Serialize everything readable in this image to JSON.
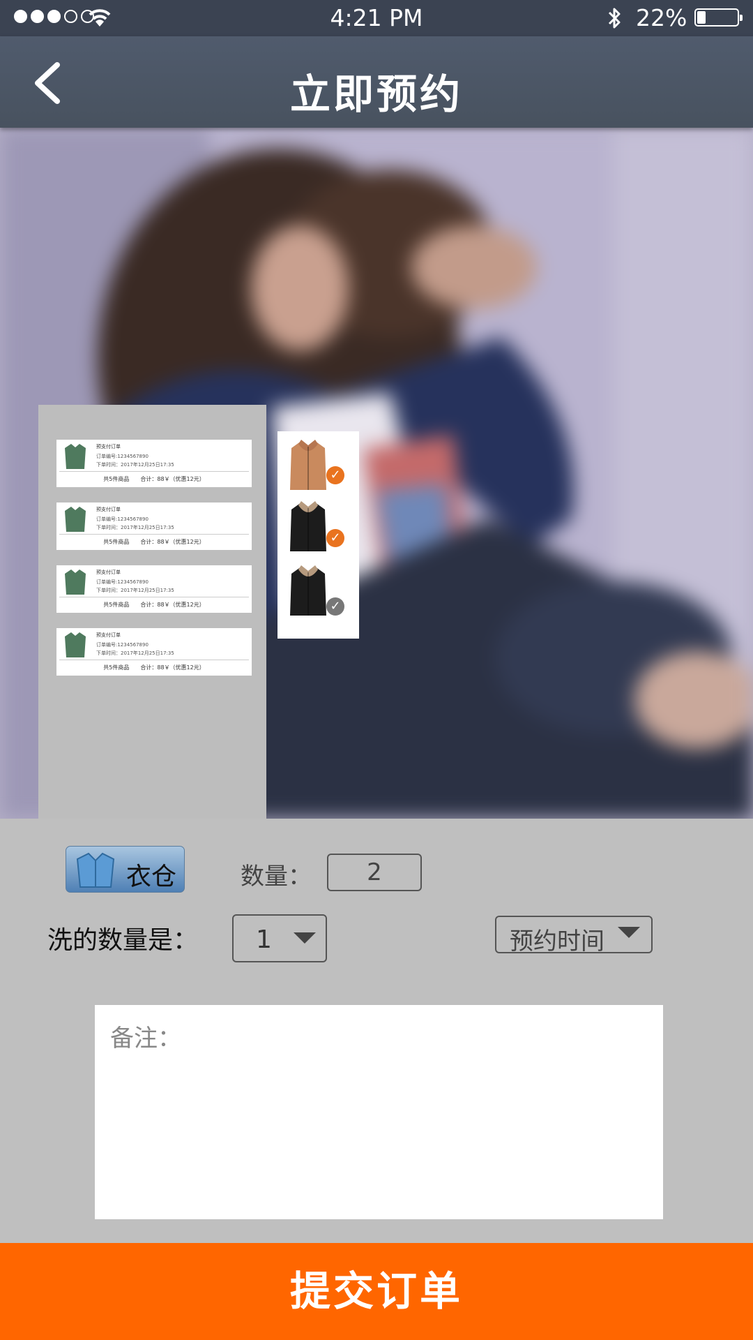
{
  "status_bar": {
    "time": "4:21 PM",
    "battery_percent": "22%",
    "battery_level": 0.22,
    "signal_bars": 3,
    "signal_total": 5
  },
  "nav": {
    "title": "立即预约",
    "back_icon": "chevron-left-icon"
  },
  "orders": [
    {
      "title": "预支付订单",
      "order_no": "订单编号:1234567890",
      "order_time": "下单时间：2017年12月25日17:35",
      "summary": "共5件商品　　合计：88￥（优惠12元）"
    },
    {
      "title": "预支付订单",
      "order_no": "订单编号:1234567890",
      "order_time": "下单时间：2017年12月25日17:35",
      "summary": "共5件商品　　合计：88￥（优惠12元）"
    },
    {
      "title": "预支付订单",
      "order_no": "订单编号:1234567890",
      "order_time": "下单时间：2017年12月25日17:35",
      "summary": "共5件商品　　合计：88￥（优惠12元）"
    },
    {
      "title": "预支付订单",
      "order_no": "订单编号:1234567890",
      "order_time": "下单时间：2017年12月25日17:35",
      "summary": "共5件商品　　合计：88￥（优惠12元）"
    }
  ],
  "picker": {
    "items": [
      {
        "item": "camel-coat-icon",
        "selected": true
      },
      {
        "item": "black-fur-coat-icon",
        "selected": true
      },
      {
        "item": "black-fur-coat-icon",
        "selected": false
      }
    ],
    "colors": {
      "selected": "#e9731f",
      "unselected": "#777777"
    }
  },
  "form": {
    "wardrobe_label": "衣仓",
    "quantity_label": "数量：",
    "quantity_value": "2",
    "wash_count_label": "洗的数量是：",
    "wash_count_value": "1",
    "appointment_time_label": "预约时间",
    "remark_placeholder": "备注："
  },
  "submit": {
    "label": "提交订单",
    "color": "#ff6600"
  }
}
